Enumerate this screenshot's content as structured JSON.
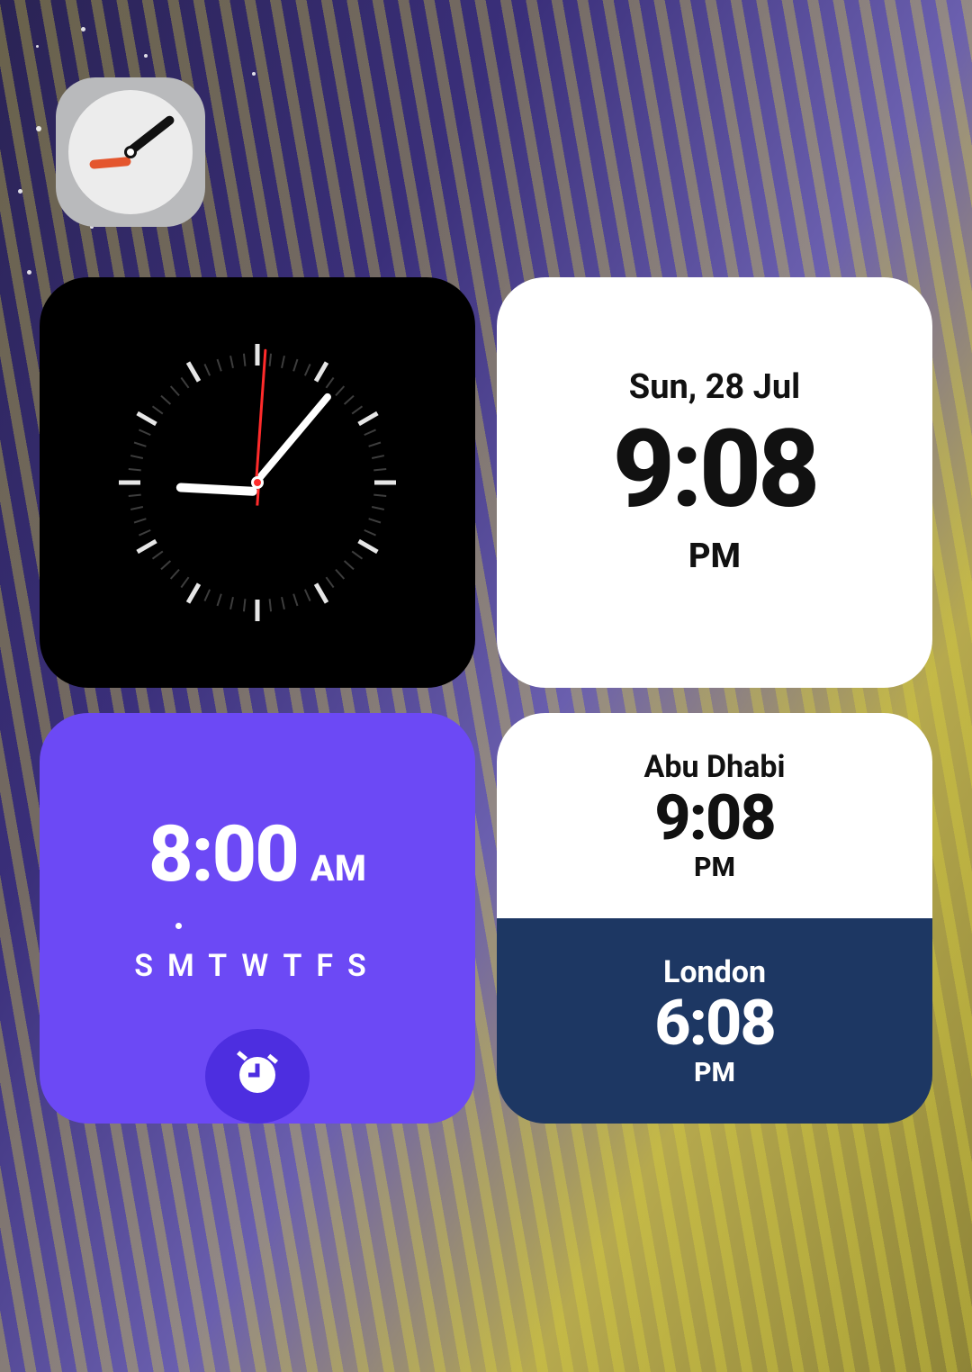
{
  "digital": {
    "date": "Sun, 28 Jul",
    "time": "9:08",
    "ampm": "PM"
  },
  "alarm": {
    "time": "8:00",
    "ampm": "AM",
    "days": "SMTWTFS"
  },
  "world": {
    "city1": {
      "name": "Abu Dhabi",
      "time": "9:08",
      "ampm": "PM"
    },
    "city2": {
      "name": "London",
      "time": "6:08",
      "ampm": "PM"
    }
  },
  "analog": {
    "hour": 9,
    "minute": 8,
    "second": 3
  }
}
